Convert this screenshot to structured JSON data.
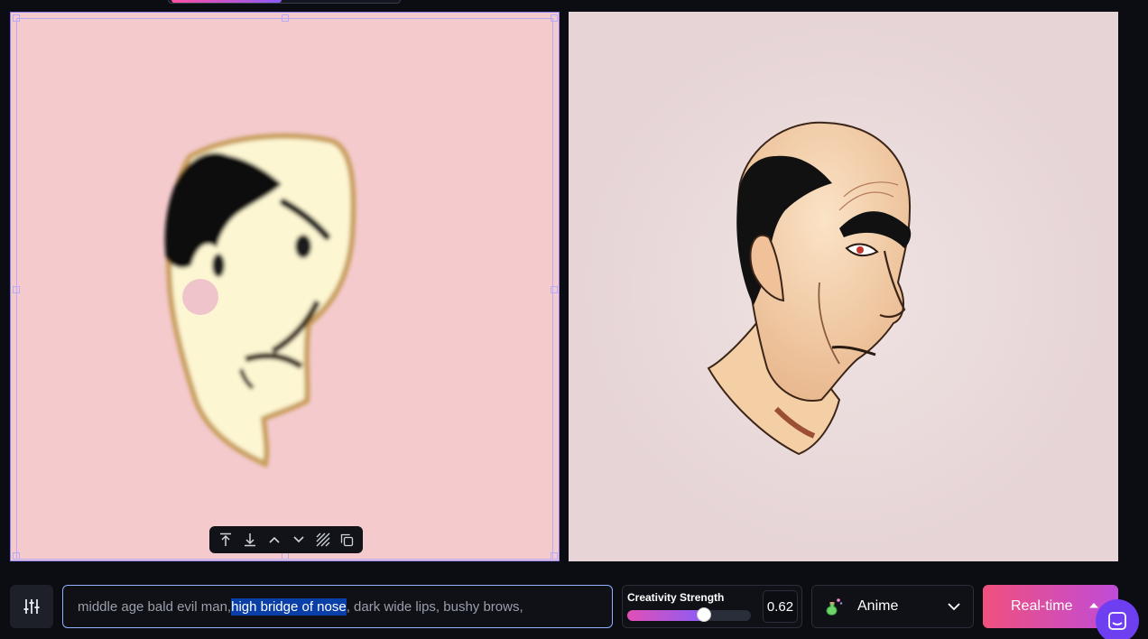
{
  "canvas": {
    "background": "#f4cacd",
    "toolbar": {
      "items": [
        "move-to-top",
        "move-to-bottom",
        "move-up",
        "move-down",
        "fill-pattern",
        "duplicate"
      ]
    }
  },
  "result": {
    "background": "#e6d4d6"
  },
  "prompt": {
    "before": "middle age bald evil man, ",
    "selected": "high bridge of nose",
    "after": " , dark wide lips, bushy brows,"
  },
  "strength": {
    "label": "Creativity Strength",
    "value": "0.62",
    "fraction": 0.62
  },
  "style": {
    "name": "Anime",
    "icon": "potion-icon"
  },
  "generate": {
    "label": "Real-time"
  },
  "colors": {
    "accent_gradient_start": "#f0507d",
    "accent_gradient_end": "#c04bd8",
    "selection": "#0b3fa8"
  }
}
